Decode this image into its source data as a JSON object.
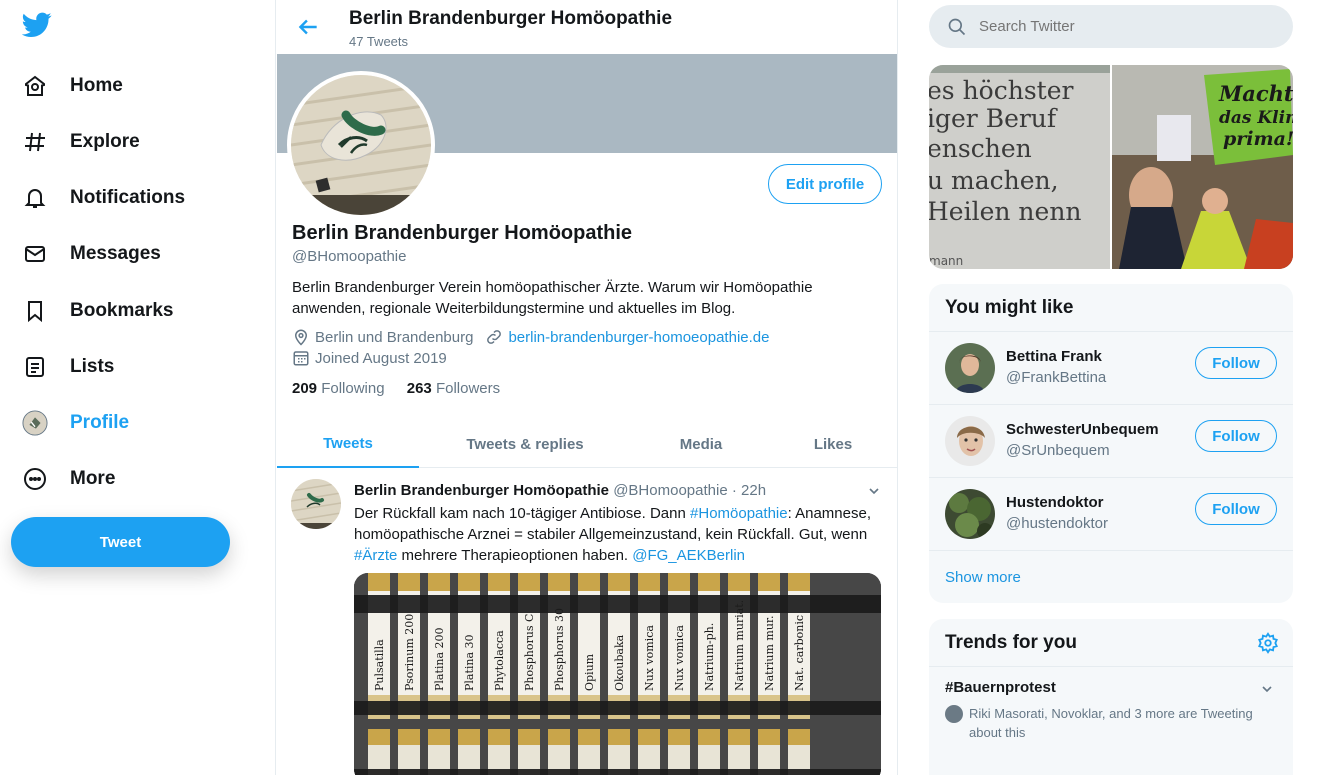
{
  "nav": {
    "items": [
      {
        "label": "Home",
        "icon": "home-icon"
      },
      {
        "label": "Explore",
        "icon": "hashtag-icon"
      },
      {
        "label": "Notifications",
        "icon": "bell-icon"
      },
      {
        "label": "Messages",
        "icon": "envelope-icon"
      },
      {
        "label": "Bookmarks",
        "icon": "bookmark-icon"
      },
      {
        "label": "Lists",
        "icon": "list-icon"
      },
      {
        "label": "Profile",
        "icon": "avatar-icon"
      },
      {
        "label": "More",
        "icon": "more-icon"
      }
    ],
    "tweet_button": "Tweet"
  },
  "header": {
    "title": "Berlin Brandenburger Homöopathie",
    "tweet_count": "47 Tweets"
  },
  "profile": {
    "name": "Berlin Brandenburger Homöopathie",
    "handle": "@BHomoopathie",
    "bio": "Berlin Brandenburger Verein homöopathischer Ärzte. Warum wir Homöopathie anwenden, regionale Weiterbildungstermine und aktuelles im Blog.",
    "location": "Berlin und Brandenburg",
    "website": "berlin-brandenburger-homoeopathie.de",
    "joined": "Joined August 2019",
    "following_count": "209",
    "following_label": "Following",
    "followers_count": "263",
    "followers_label": "Followers",
    "edit_button": "Edit profile"
  },
  "tabs": [
    "Tweets",
    "Tweets & replies",
    "Media",
    "Likes"
  ],
  "tweet": {
    "name": "Berlin Brandenburger Homöopathie",
    "handle": "@BHomoopathie",
    "time": "· 22h",
    "text_1": "Der Rückfall kam nach 10-tägiger Antibiose. Dann ",
    "tag_1": "#Homöopathie",
    "text_2": ": Anamnese, homöopathische Arznei = stabiler Allgemeinzustand, kein Rückfall. Gut, wenn ",
    "tag_2": "#Ärzte",
    "text_3": " mehrere Therapieoptionen haben. ",
    "mention": "@FG_AEKBerlin",
    "vial_labels": [
      "Pulsatilla",
      "Psorinum 200",
      "Platina 200",
      "Platina 30",
      "Phytolacca",
      "Phosphorus C",
      "Phosphorus 30",
      "Opium",
      "Okoubaka",
      "Nux vomica",
      "Nux vomica",
      "Natrium-ph.",
      "Natrium muriat.",
      "Natrium mur.",
      "Nat. carbonic"
    ]
  },
  "search": {
    "placeholder": "Search Twitter"
  },
  "photos": {
    "sign_lines": [
      "es höchster",
      "iger Beruf",
      "enschen",
      "u machen,",
      "Heilen nenn",
      "mann"
    ],
    "protest_sign": [
      "Macht",
      "das Klima",
      "prima!"
    ]
  },
  "who_to_follow": {
    "title": "You might like",
    "users": [
      {
        "name": "Bettina Frank",
        "handle": "@FrankBettina",
        "button": "Follow"
      },
      {
        "name": "SchwesterUnbequem",
        "handle": "@SrUnbequem",
        "button": "Follow"
      },
      {
        "name": "Hustendoktor",
        "handle": "@hustendoktor",
        "button": "Follow"
      }
    ],
    "show_more": "Show more"
  },
  "trends": {
    "title": "Trends for you",
    "items": [
      {
        "tag": "#Bauernprotest",
        "sub": "Riki Masorati, Novoklar, and 3 more are Tweeting about this"
      }
    ]
  },
  "colors": {
    "accent": "#1da1f2",
    "text": "#14171a",
    "muted": "#657786",
    "banner": "#aab8c2",
    "panel": "#f5f8fa"
  }
}
